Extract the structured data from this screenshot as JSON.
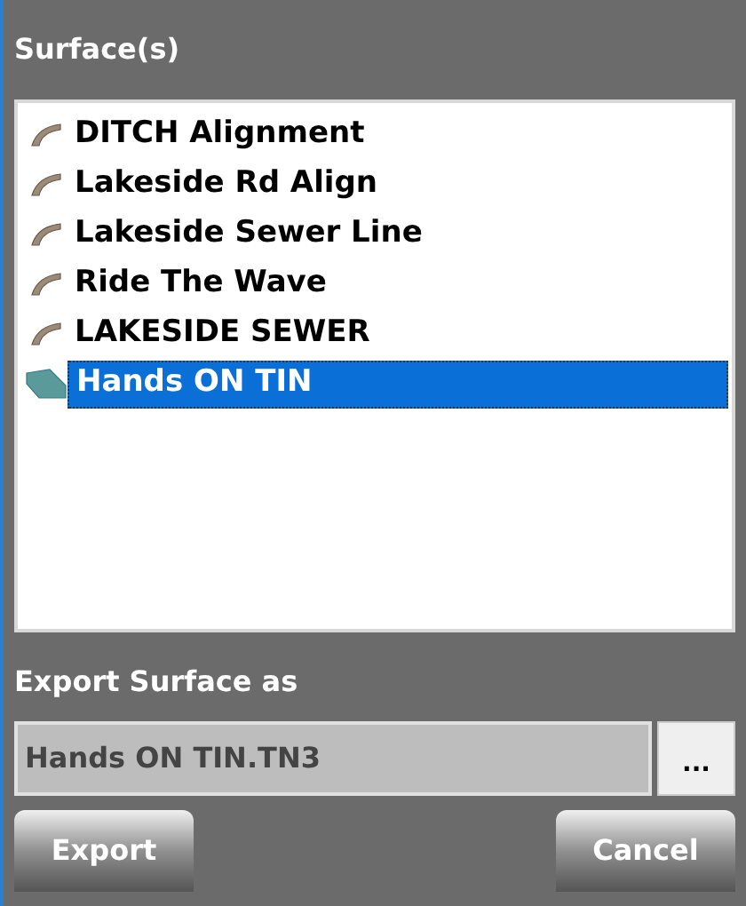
{
  "title": "Surface(s)",
  "surfaces": [
    {
      "label": "DITCH Alignment",
      "kind": "alignment",
      "selected": false
    },
    {
      "label": "Lakeside Rd Align",
      "kind": "alignment",
      "selected": false
    },
    {
      "label": "Lakeside Sewer Line",
      "kind": "alignment",
      "selected": false
    },
    {
      "label": "Ride The Wave",
      "kind": "alignment",
      "selected": false
    },
    {
      "label": "LAKESIDE SEWER",
      "kind": "alignment",
      "selected": false
    },
    {
      "label": "Hands ON TIN",
      "kind": "tin",
      "selected": true
    }
  ],
  "export_label": "Export Surface as",
  "export_field": {
    "value": "Hands ON TIN.TN3"
  },
  "browse_button": "...",
  "buttons": [
    "Export",
    "Cancel"
  ]
}
